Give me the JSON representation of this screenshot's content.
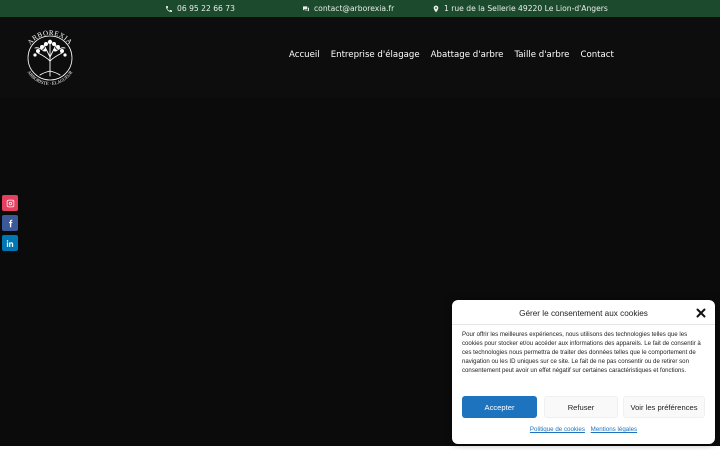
{
  "topbar": {
    "phone": "06 95 22 66 73",
    "email": "contact@arborexia.fr",
    "address": "1 rue de la Sellerie 49220 Le Lion-d'Angers",
    "bg_color": "#1c4a2c"
  },
  "logo": {
    "text_top": "ARBOREXIA",
    "text_bottom": "ARBORISTE · ÉLAGUEUR"
  },
  "nav": {
    "items": [
      "Accueil",
      "Entreprise d'élagage",
      "Abattage d'arbre",
      "Taille d'arbre",
      "Contact"
    ]
  },
  "social": {
    "icons": [
      "instagram-icon",
      "facebook-icon",
      "linkedin-icon"
    ],
    "colors": [
      "#e4405f",
      "#3b5998",
      "#0077b5"
    ]
  },
  "cookie": {
    "title": "Gérer le consentement aux cookies",
    "text": "Pour offrir les meilleures expériences, nous utilisons des technologies telles que les cookies pour stocker et/ou accéder aux informations des appareils. Le fait de consentir à ces technologies nous permettra de traiter des données telles que le comportement de navigation ou les ID uniques sur ce site. Le fait de ne pas consentir ou de retirer son consentement peut avoir un effet négatif sur certaines caractéristiques et fonctions.",
    "accept": "Accepter",
    "refuse": "Refuser",
    "preferences": "Voir les préférences",
    "link_cookies": "Politique de cookies",
    "link_legal": "Mentions légales",
    "accent_color": "#1e73be"
  }
}
